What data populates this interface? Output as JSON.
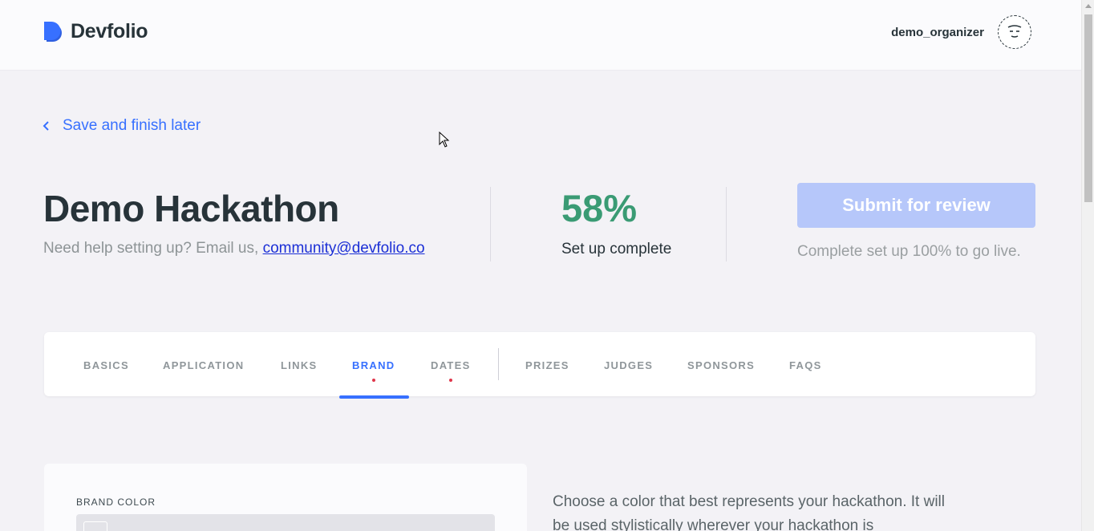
{
  "header": {
    "logo_text": "Devfolio",
    "username": "demo_organizer",
    "avatar_icon": "face-avatar-icon"
  },
  "back_link": {
    "label": "Save and finish later",
    "icon": "chevron-left-icon"
  },
  "hackathon": {
    "title": "Demo Hackathon",
    "help_prefix": "Need help setting up? Email us, ",
    "help_email": "community@devfolio.co"
  },
  "progress": {
    "value": "58%",
    "label": "Set up complete",
    "fraction": 0.58,
    "color": "#3a9b74"
  },
  "submit": {
    "label": "Submit for review",
    "note": "Complete set up 100% to go live.",
    "color": "#b6c7fa"
  },
  "tabs": [
    {
      "label": "BASICS",
      "active": false,
      "dot": false
    },
    {
      "label": "APPLICATION",
      "active": false,
      "dot": false
    },
    {
      "label": "LINKS",
      "active": false,
      "dot": false
    },
    {
      "label": "BRAND",
      "active": true,
      "dot": true
    },
    {
      "label": "DATES",
      "active": false,
      "dot": true
    },
    {
      "label": "PRIZES",
      "active": false,
      "dot": false
    },
    {
      "label": "JUDGES",
      "active": false,
      "dot": false
    },
    {
      "label": "SPONSORS",
      "active": false,
      "dot": false
    },
    {
      "label": "FAQS",
      "active": false,
      "dot": false
    }
  ],
  "brand_card": {
    "label": "BRAND COLOR"
  },
  "description": "Choose a color that best represents your hackathon. It will be used stylistically wherever your hackathon is",
  "colors": {
    "accent": "#3770ff",
    "dot": "#e0364b",
    "text": "#273339"
  }
}
